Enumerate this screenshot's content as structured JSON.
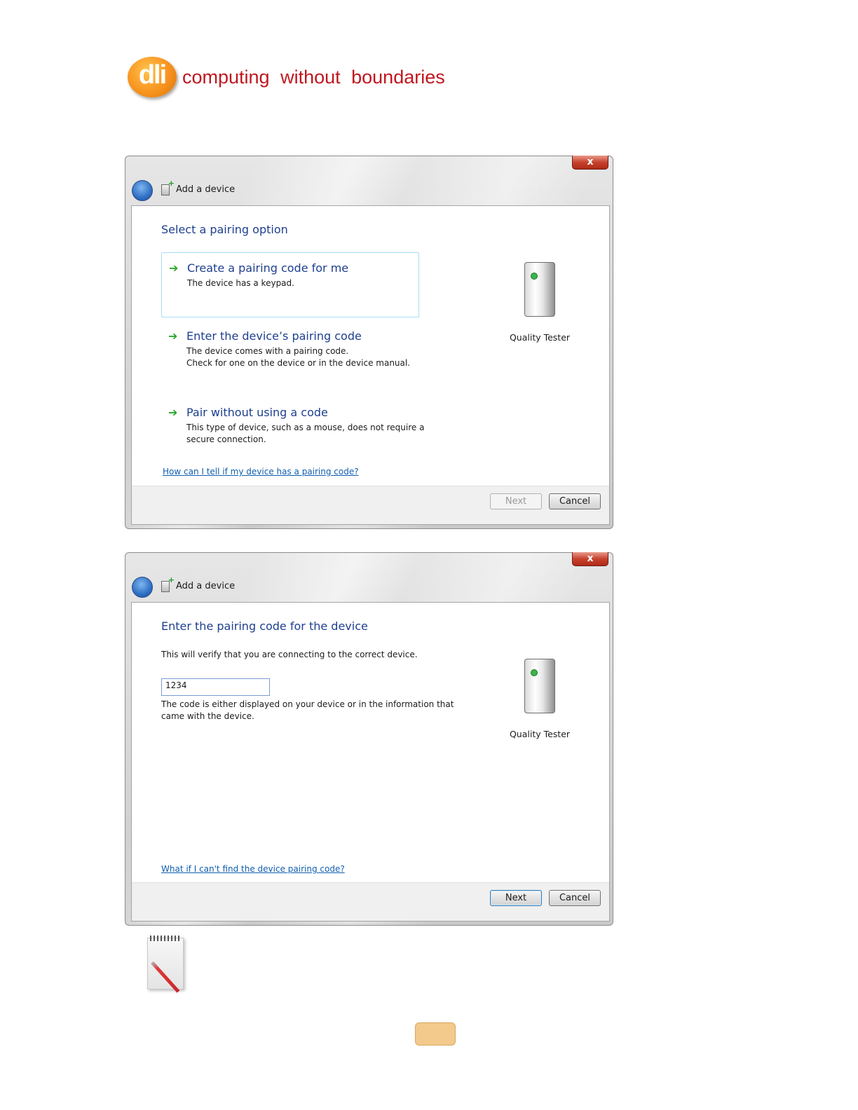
{
  "brand": {
    "logo_text": "dli",
    "tagline": "computing  without  boundaries",
    "colors": {
      "logo_orange": "#f7931e",
      "tagline_red": "#c0171f"
    }
  },
  "dialog1": {
    "close_label": "x",
    "title": "Add a device",
    "heading": "Select a pairing option",
    "options": [
      {
        "title": "Create a pairing code for me",
        "description": "The device has a keypad.",
        "selected": true
      },
      {
        "title": "Enter the device’s pairing code",
        "description_lines": [
          "The device comes with a pairing code.",
          "Check for one on the device or in the device manual."
        ]
      },
      {
        "title": "Pair without using a code",
        "description_lines": [
          "This type of device, such as a mouse, does not require a",
          "secure connection."
        ]
      }
    ],
    "help_link": "How can I tell if my device has a pairing code?",
    "device_name": "Quality Tester",
    "next_label": "Next",
    "next_enabled": false,
    "cancel_label": "Cancel"
  },
  "dialog2": {
    "close_label": "x",
    "title": "Add a device",
    "heading": "Enter the pairing code for the device",
    "intro": "This will verify that you are connecting to the correct device.",
    "code_value": "1234",
    "hint_lines": [
      "The code is either displayed on your device or in the information that",
      "came with the device."
    ],
    "help_link": "What if I can't find the device pairing code?",
    "device_name": "Quality Tester",
    "next_label": "Next",
    "next_enabled": true,
    "cancel_label": "Cancel"
  },
  "icons": {
    "logo": "dli-logo-badge",
    "back": "back-arrow-icon",
    "add_device": "add-device-icon",
    "option_arrow": "green-arrow-icon",
    "device": "tower-device-icon",
    "note": "notepad-icon"
  }
}
